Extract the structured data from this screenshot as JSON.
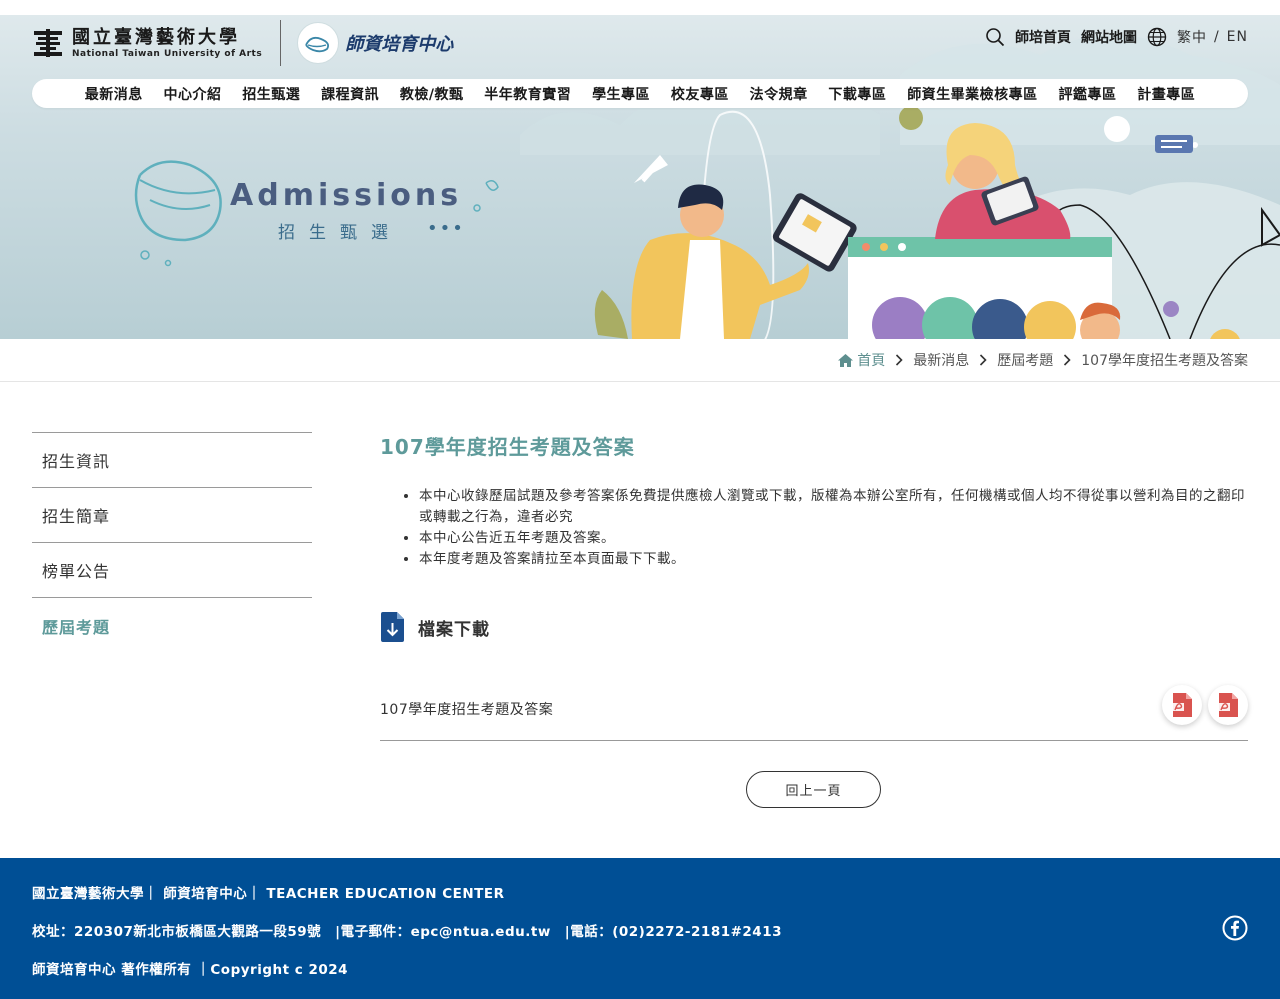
{
  "header": {
    "univ_name_zh": "國立臺灣藝術大學",
    "univ_name_en": "National Taiwan University of Arts",
    "center_name": "師資培育中心",
    "top_links": [
      "師培首頁",
      "網站地圖"
    ],
    "lang_zh": "繁中",
    "lang_sep": "/",
    "lang_en": "EN"
  },
  "nav": [
    "最新消息",
    "中心介紹",
    "招生甄選",
    "課程資訊",
    "教檢/教甄",
    "半年教育實習",
    "學生專區",
    "校友專區",
    "法令規章",
    "下載專區",
    "師資生畢業檢核專區",
    "評鑑專區",
    "計畫專區"
  ],
  "banner": {
    "title_en": "Admissions",
    "title_zh": "招生甄選",
    "dots": "•••"
  },
  "breadcrumb": {
    "home": "首頁",
    "items": [
      "最新消息",
      "歷屆考題",
      "107學年度招生考題及答案"
    ],
    "sep": "〉"
  },
  "sidebar": {
    "items": [
      "招生資訊",
      "招生簡章",
      "榜單公告",
      "歷屆考題"
    ],
    "active": "歷屆考題"
  },
  "main": {
    "title": "107學年度招生考題及答案",
    "notices": [
      "本中心收錄歷屆試題及參考答案係免費提供應檢人瀏覽或下載，版權為本辦公室所有，任何機構或個人均不得從事以營利為目的之翻印或轉載之行為，違者必究",
      "本中心公告近五年考題及答案。",
      "本年度考題及答案請拉至本頁面最下下載。"
    ],
    "download_heading": "檔案下載",
    "files": [
      {
        "name": "107學年度招生考題及答案",
        "icons": [
          "pdf-icon",
          "pdf-icon"
        ]
      }
    ],
    "back_label": "回上一頁"
  },
  "footer": {
    "line1": "國立臺灣藝術大學｜ 師資培育中心｜ TEACHER EDUCATION CENTER",
    "line2": "校址：220307新北市板橋區大觀路一段59號　|電子郵件：epc@ntua.edu.tw　|電話：(02)2272-2181#2413",
    "line3": "師資培育中心 著作權所有 ｜Copyright c 2024",
    "social_icon": "facebook-icon"
  },
  "colors": {
    "accent": "#5e9a9a",
    "footer_bg": "#004f95",
    "pdf_red": "#d9534f"
  }
}
